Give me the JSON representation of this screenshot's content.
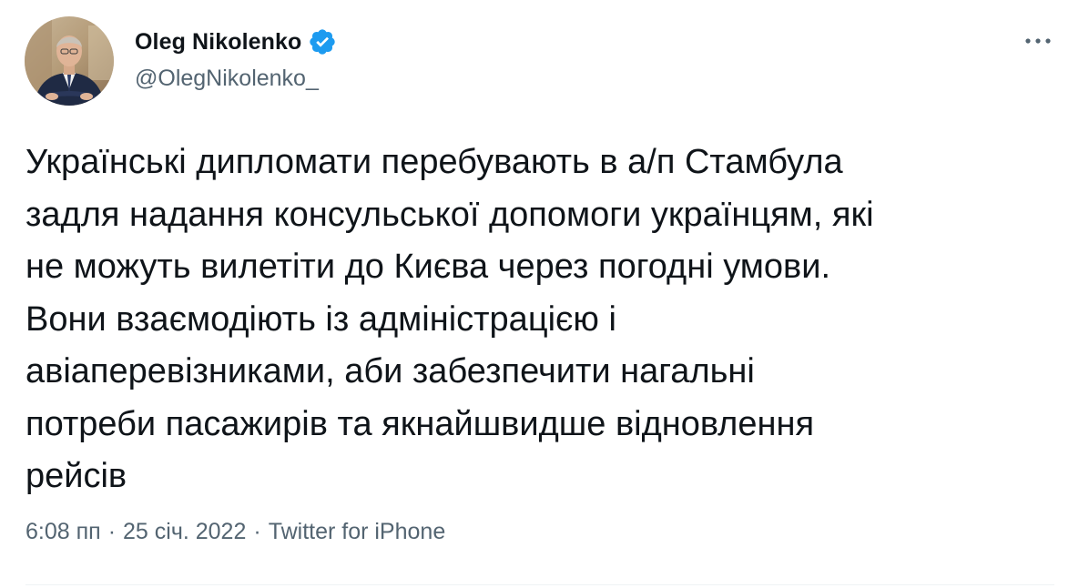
{
  "author": {
    "display_name": "Oleg Nikolenko",
    "handle": "@OlegNikolenko_",
    "verified": true,
    "verified_icon": "verified-badge-icon",
    "avatar_icon": "avatar"
  },
  "more_icon": "more-horizontal-icon",
  "tweet": {
    "text": "Українські дипломати перебувають в а/п Стамбула\nзадля надання консульської допомоги українцям, які\nне можуть вилетіти до Києва через погодні умови.\nВони взаємодіють із адміністрацією і\nавіаперевізниками, аби забезпечити нагальні\nпотреби пасажирів та якнайшвидше відновлення\nрейсів"
  },
  "meta": {
    "time": "6:08 пп",
    "separator": "·",
    "date": "25 січ. 2022",
    "source": "Twitter for iPhone"
  },
  "colors": {
    "text": "#0f1419",
    "secondary": "#536471",
    "verified": "#1d9bf0",
    "divider": "#eff3f4"
  }
}
